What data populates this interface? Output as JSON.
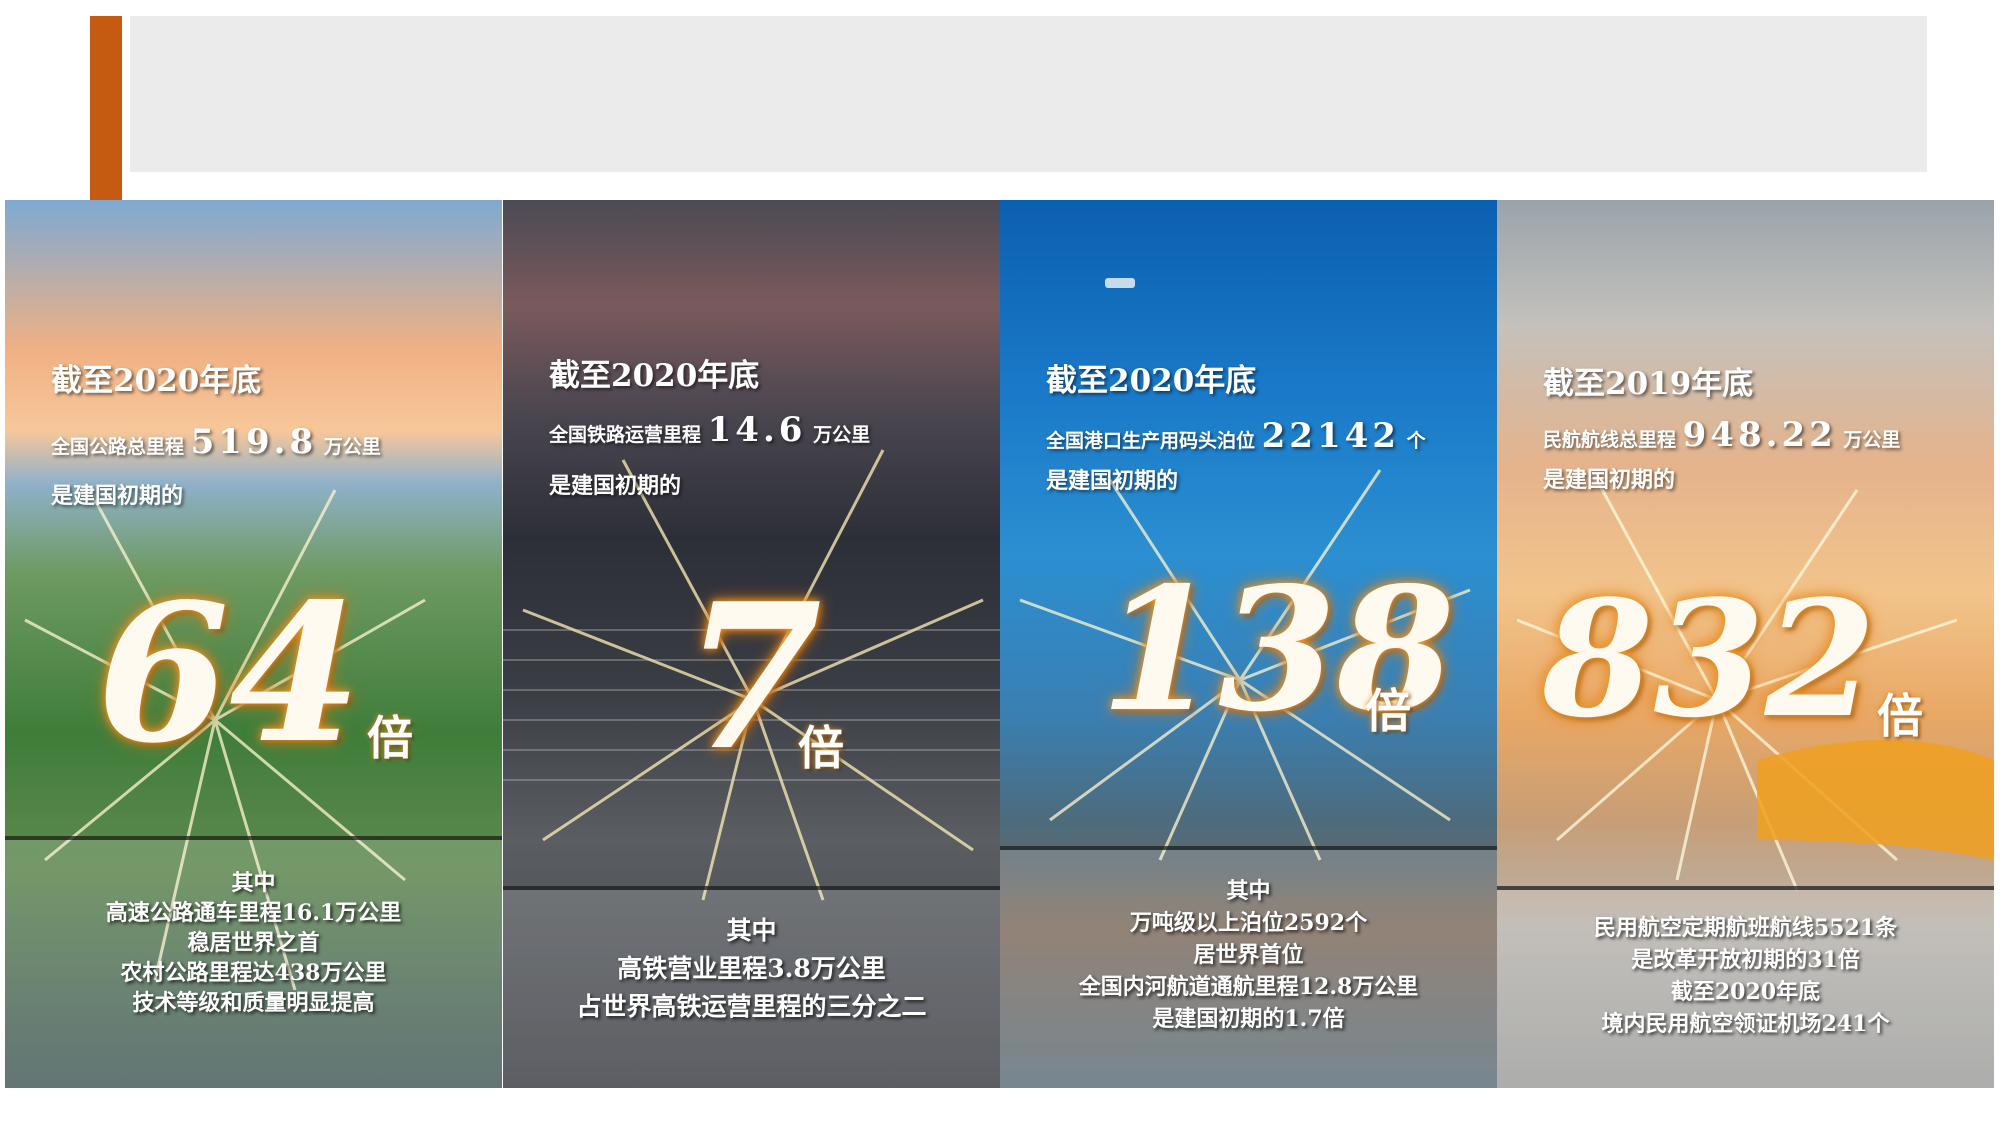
{
  "panels": [
    {
      "as_of": "截至2020年底",
      "stat_prefix": "全国公路总里程",
      "stat_value": "519.8",
      "stat_suffix": "万公里",
      "comparison": "是建国初期的",
      "multiplier": "64",
      "times": "倍",
      "detail": [
        "其中",
        "高速公路通车里程16.1万公里",
        "稳居世界之首",
        "农村公路里程达438万公里",
        "技术等级和质量明显提高"
      ]
    },
    {
      "as_of": "截至2020年底",
      "stat_prefix": "全国铁路运营里程",
      "stat_value": "14.6",
      "stat_suffix": "万公里",
      "comparison": "是建国初期的",
      "multiplier": "7",
      "times": "倍",
      "detail": [
        "其中",
        "高铁营业里程3.8万公里",
        "占世界高铁运营里程的三分之二"
      ]
    },
    {
      "as_of": "截至2020年底",
      "stat_prefix": "全国港口生产用码头泊位",
      "stat_value": "22142",
      "stat_suffix": "个",
      "comparison": "是建国初期的",
      "multiplier": "138",
      "times": "倍",
      "detail": [
        "其中",
        "万吨级以上泊位2592个",
        "居世界首位",
        "全国内河航道通航里程12.8万公里",
        "是建国初期的1.7倍"
      ]
    },
    {
      "as_of": "截至2019年底",
      "stat_prefix": "民航航线总里程",
      "stat_value": "948.22",
      "stat_suffix": "万公里",
      "comparison": "是建国初期的",
      "multiplier": "832",
      "times": "倍",
      "detail": [
        "民用航空定期航班航线5521条",
        "是改革开放初期的31倍",
        "截至2020年底",
        "境内民用航空领证机场241个"
      ]
    }
  ]
}
